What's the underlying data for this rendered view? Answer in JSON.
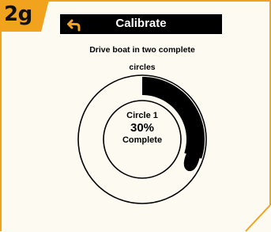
{
  "step": {
    "badge": "2g"
  },
  "header": {
    "title": "Calibrate",
    "back_icon": "back-arrow-icon"
  },
  "instruction": {
    "line1": "Drive boat in two complete",
    "line2": "circles"
  },
  "progress": {
    "circle_label": "Circle 1",
    "percent_text": "30%",
    "status_text": "Complete",
    "fraction": 0.3
  },
  "colors": {
    "accent": "#f2a31d",
    "title_bar": "#000000",
    "background": "#fdfaf1",
    "progress_fill": "#000000"
  }
}
